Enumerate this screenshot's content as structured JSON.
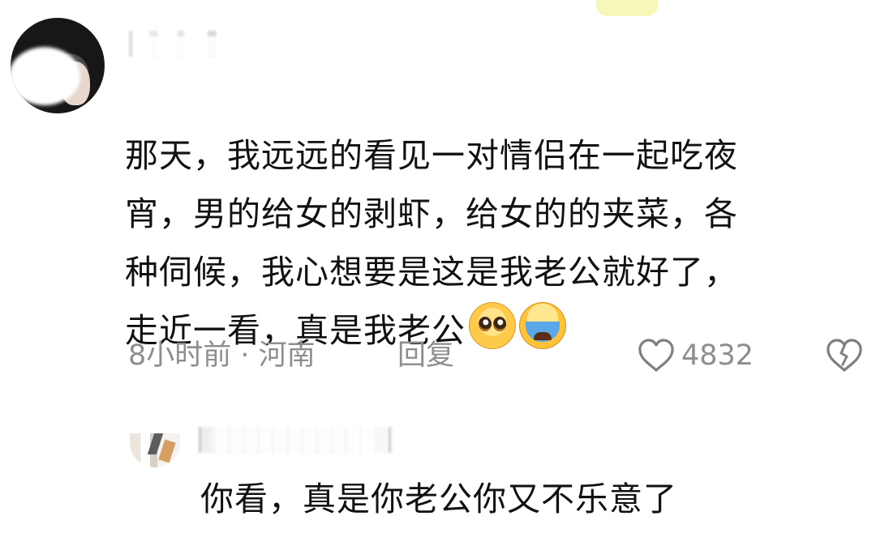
{
  "comments": [
    {
      "text": "那天，我远远的看见一对情侣在一起吃夜\n宵，男的给女的剥虾，给女的的夹菜，各\n种伺候，我心想要是这是我老公就好了，\n走近一看，真是我老公",
      "emoji_1": "pleading-face-emoji",
      "emoji_2": "loudly-crying-face-emoji",
      "time_location": "8小时前 · 河南",
      "reply_label": "回复",
      "like_count": "4832",
      "like_icon": "heart-outline-icon",
      "dislike_icon": "broken-heart-outline-icon"
    }
  ],
  "reply": {
    "text": "你看，真是你老公你又不乐意了"
  },
  "colors": {
    "text": "#111111",
    "meta": "#8e8e8e",
    "top_highlight": "#f7f8b8"
  }
}
